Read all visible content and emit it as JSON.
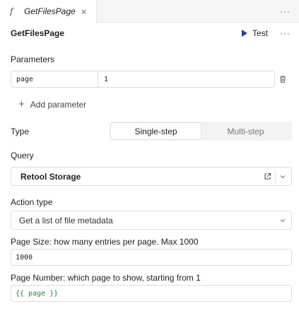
{
  "tab": {
    "icon": "function-icon",
    "glyph": "f",
    "title": "GetFilesPage",
    "close": "×",
    "more": "···"
  },
  "header": {
    "name": "GetFilesPage",
    "test_label": "Test",
    "more": "···"
  },
  "parameters": {
    "label": "Parameters",
    "rows": [
      {
        "key": "page",
        "value": "1"
      }
    ],
    "add_label": "Add parameter",
    "add_glyph": "+"
  },
  "type": {
    "label": "Type",
    "options": [
      "Single-step",
      "Multi-step"
    ],
    "selected": "Single-step"
  },
  "query": {
    "label": "Query",
    "resource": "Retool Storage"
  },
  "action_type": {
    "label": "Action type",
    "value": "Get a list of file metadata"
  },
  "page_size": {
    "label": "Page Size: how many entries per page. Max 1000",
    "value": "1000"
  },
  "page_number": {
    "label": "Page Number: which page to show, starting from 1",
    "value": "{{ page }}"
  },
  "colors": {
    "accent": "#2a3b8f",
    "template_green": "#2e7d32",
    "border": "#dcdcdc"
  }
}
